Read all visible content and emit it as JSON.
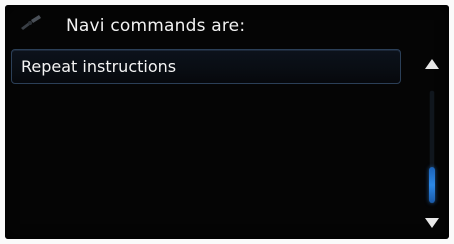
{
  "header": {
    "title": "Navi commands are:",
    "icon": "voice-command-icon"
  },
  "commands": {
    "items": [
      {
        "label": "Repeat instructions"
      }
    ]
  },
  "scrollbar": {
    "up_icon": "scroll-up-arrow-icon",
    "down_icon": "scroll-down-arrow-icon",
    "position_fraction": 1.0,
    "accent_color": "#2a86e4"
  },
  "colors": {
    "background": "#050505",
    "text": "#f2f2f2",
    "item_border": "#2b3f57"
  }
}
